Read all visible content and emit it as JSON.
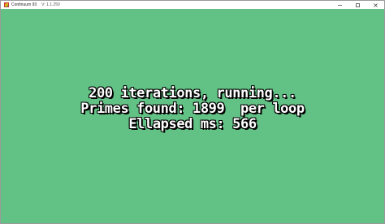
{
  "window": {
    "title": "Continuum 93",
    "version": "V: 1.1.250",
    "controls": [
      {
        "name": "minimize",
        "glyph": "minimize-icon"
      },
      {
        "name": "maximize",
        "glyph": "maximize-icon"
      },
      {
        "name": "close",
        "glyph": "close-icon"
      }
    ]
  },
  "screen": {
    "background_color": "#62c184",
    "lines": [
      "200 iterations, running...",
      "Primes found: 1899  per loop",
      "Ellapsed ms: 566"
    ]
  }
}
